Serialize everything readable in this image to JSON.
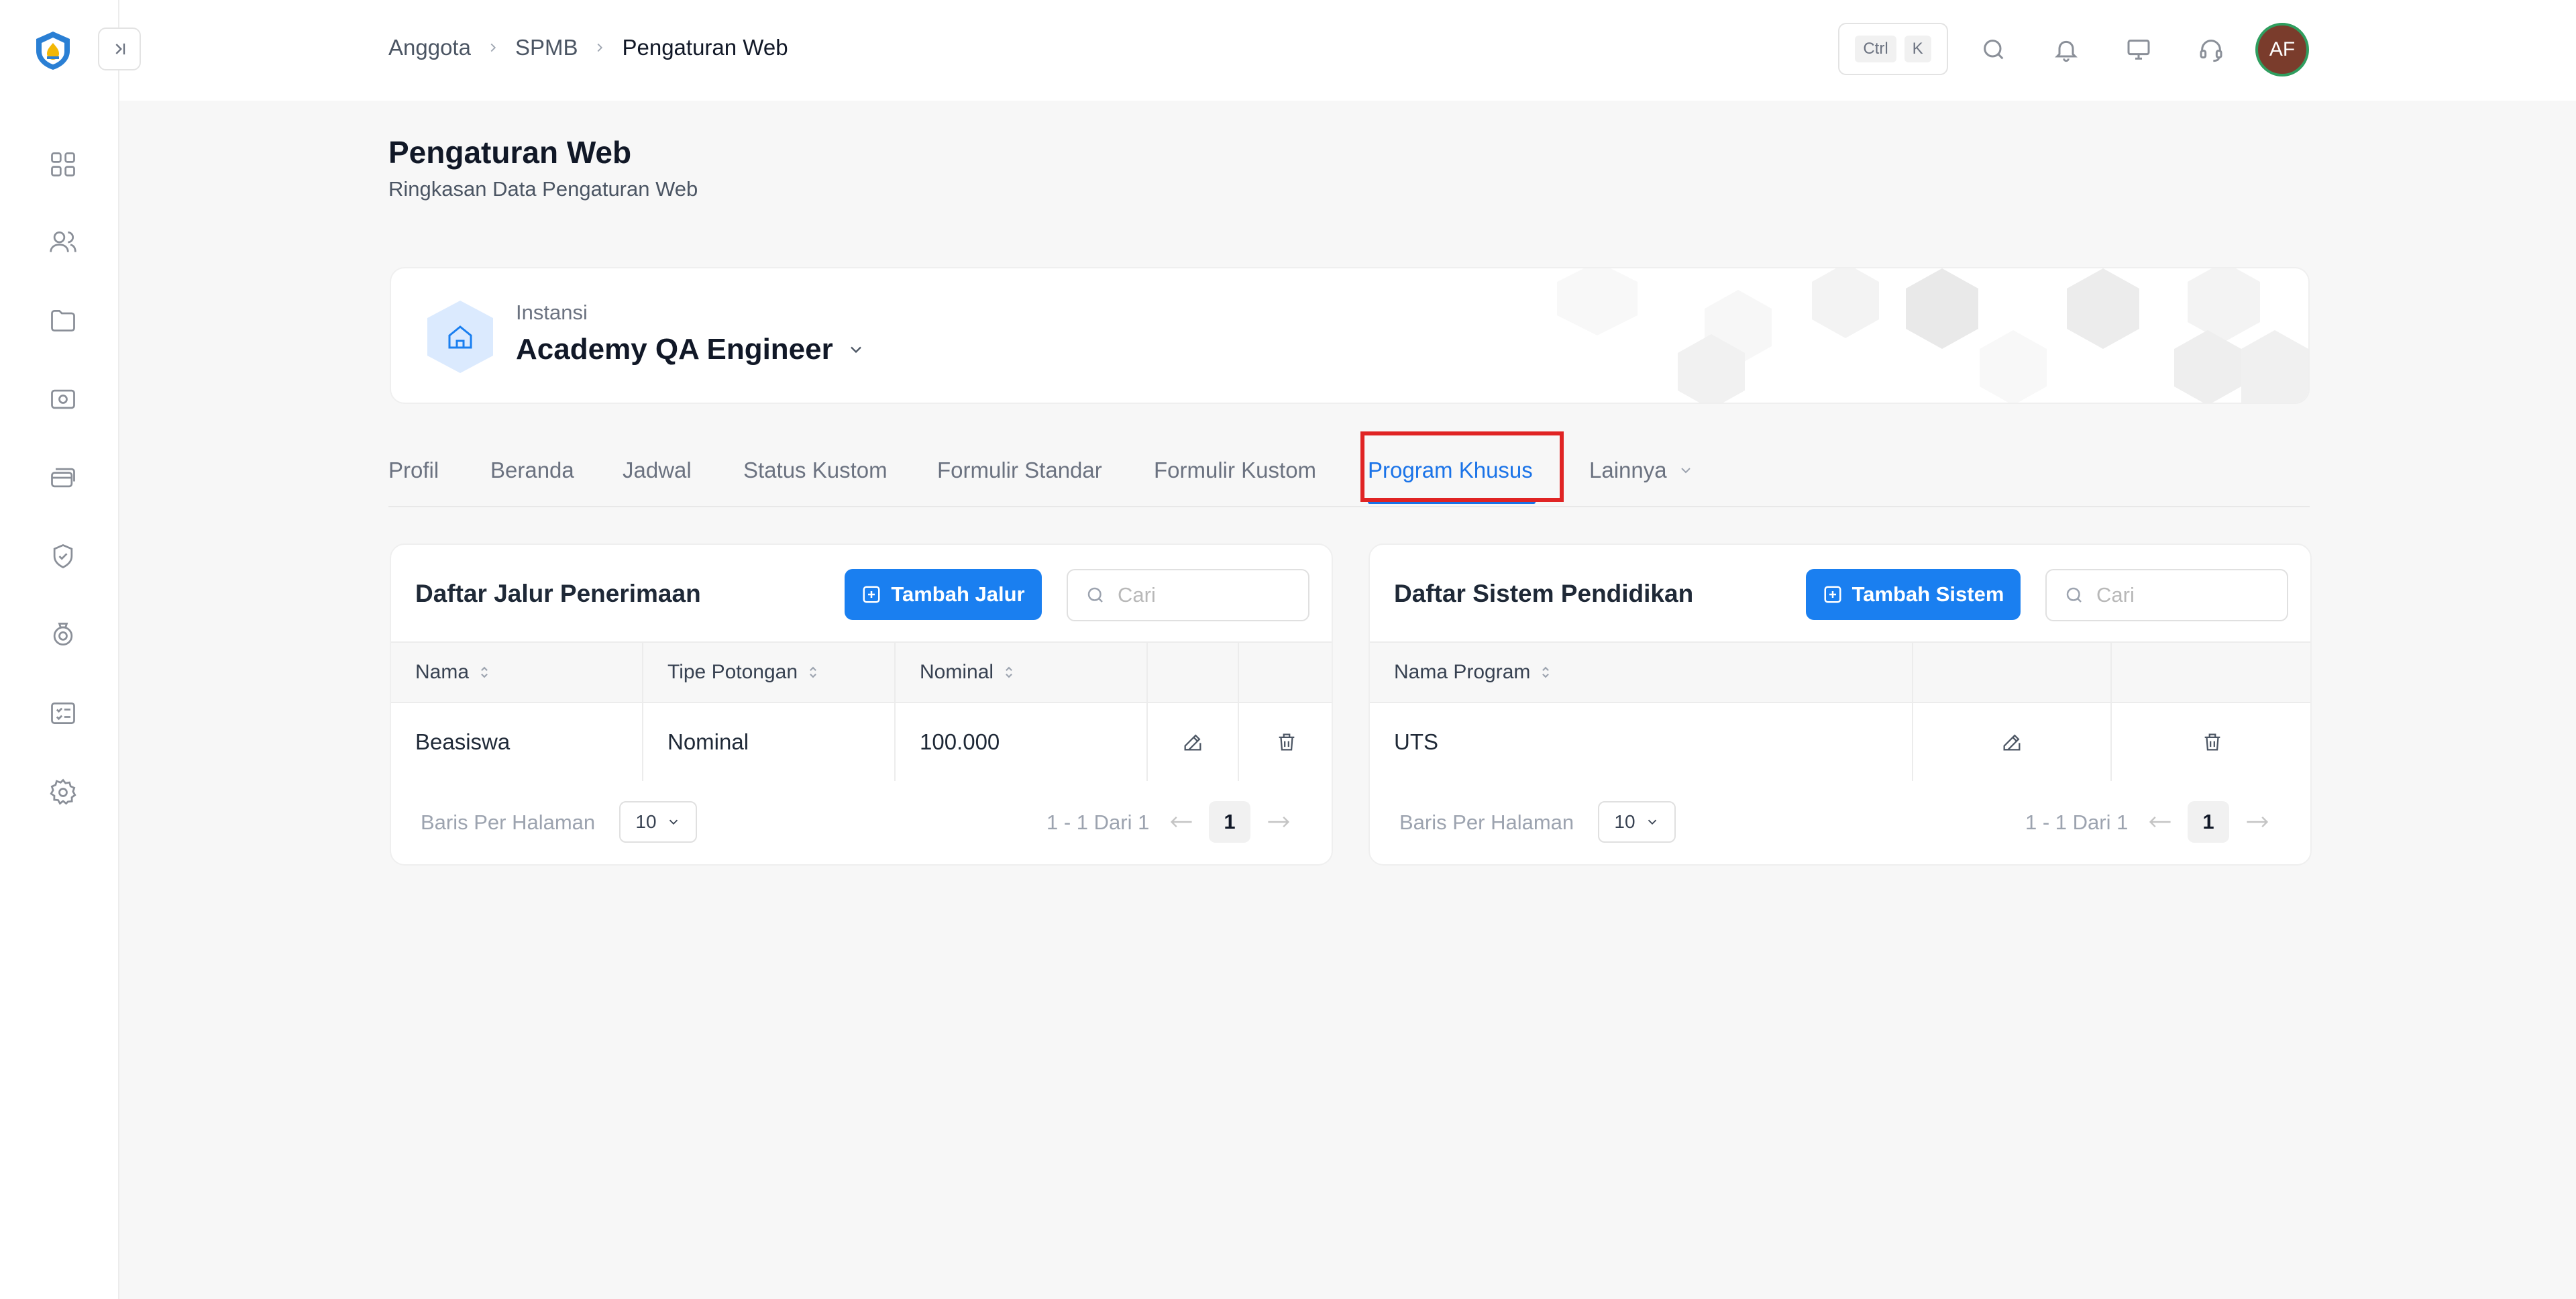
{
  "breadcrumb": [
    "Anggota",
    "SPMB",
    "Pengaturan Web"
  ],
  "shortcut": {
    "key1": "Ctrl",
    "key2": "K"
  },
  "user": {
    "initials": "AF"
  },
  "page": {
    "title": "Pengaturan Web",
    "subtitle": "Ringkasan Data Pengaturan Web"
  },
  "instansi": {
    "label": "Instansi",
    "name": "Academy QA Engineer"
  },
  "tabs": [
    {
      "label": "Profil"
    },
    {
      "label": "Beranda"
    },
    {
      "label": "Jadwal"
    },
    {
      "label": "Status Kustom"
    },
    {
      "label": "Formulir Standar"
    },
    {
      "label": "Formulir Kustom"
    },
    {
      "label": "Program Khusus",
      "active": true
    },
    {
      "label": "Lainnya"
    }
  ],
  "jalur": {
    "title": "Daftar Jalur Penerimaan",
    "add_label": "Tambah Jalur",
    "search_placeholder": "Cari",
    "columns": [
      "Nama",
      "Tipe Potongan",
      "Nominal"
    ],
    "rows": [
      {
        "nama": "Beasiswa",
        "tipe": "Nominal",
        "nominal": "100.000"
      }
    ],
    "rows_per_page_label": "Baris Per Halaman",
    "rows_per_page": "10",
    "page_info": "1 - 1 Dari 1",
    "current_page": "1"
  },
  "sistem": {
    "title": "Daftar Sistem Pendidikan",
    "add_label": "Tambah Sistem",
    "search_placeholder": "Cari",
    "columns": [
      "Nama Program"
    ],
    "rows": [
      {
        "nama": "UTS"
      }
    ],
    "rows_per_page_label": "Baris Per Halaman",
    "rows_per_page": "10",
    "page_info": "1 - 1 Dari 1",
    "current_page": "1"
  },
  "colors": {
    "accent": "#1a7ff0",
    "active_tab": "#1a73e8",
    "highlight": "#e02424",
    "avatar_bg": "#7a3c2c",
    "avatar_ring": "#2f9e5f"
  },
  "icons": {
    "sidebar": [
      "dashboard-icon",
      "users-icon",
      "folder-icon",
      "money-icon",
      "cards-icon",
      "badge-icon",
      "award-icon",
      "checklist-icon",
      "gear-icon"
    ],
    "topbar": [
      "search-icon",
      "bell-icon",
      "monitor-icon",
      "headset-icon"
    ]
  }
}
